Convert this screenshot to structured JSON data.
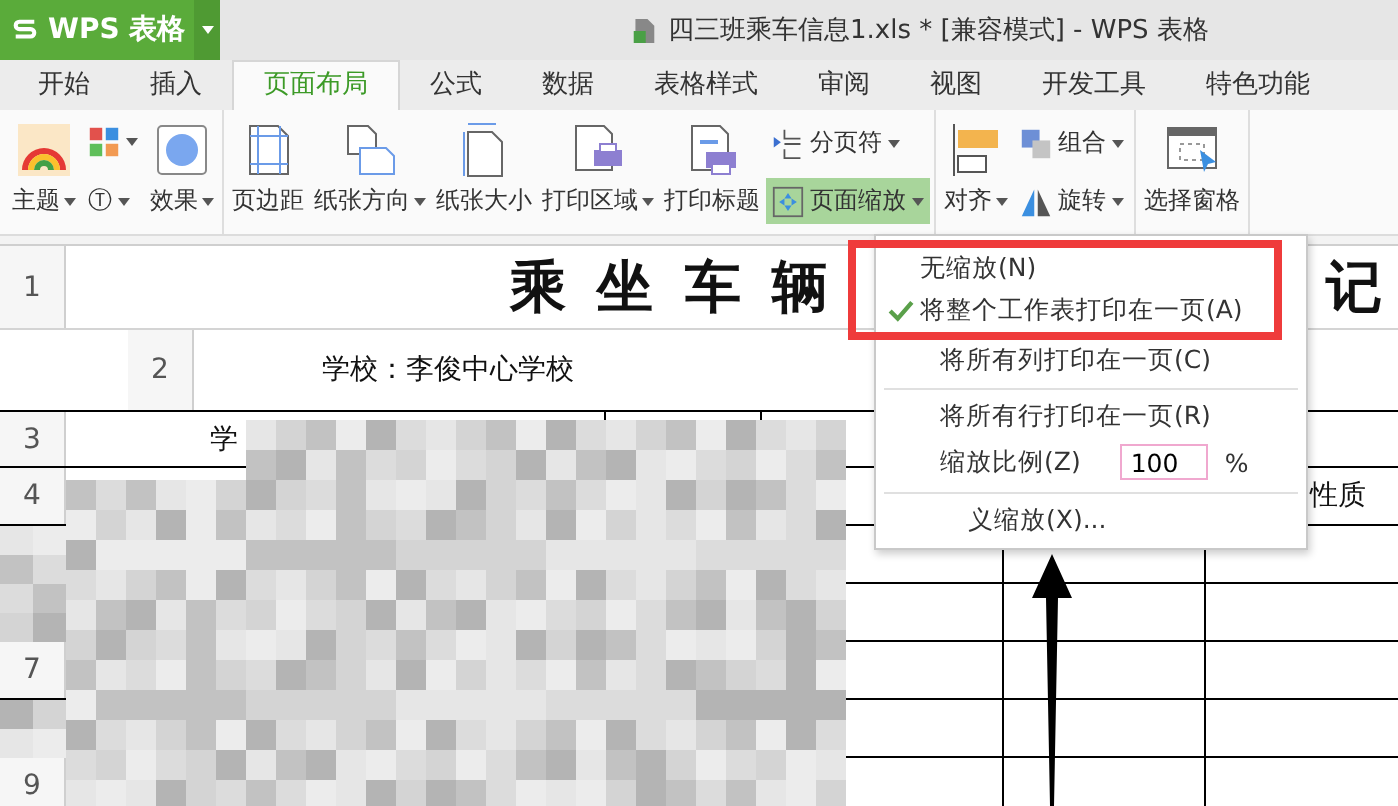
{
  "app": {
    "logo": "WPS 表格",
    "title": "四三班乘车信息1.xls * [兼容模式] - WPS 表格"
  },
  "tabs": [
    {
      "label": "开始",
      "selected": false
    },
    {
      "label": "插入",
      "selected": false
    },
    {
      "label": "页面布局",
      "selected": true
    },
    {
      "label": "公式",
      "selected": false
    },
    {
      "label": "数据",
      "selected": false
    },
    {
      "label": "表格样式",
      "selected": false
    },
    {
      "label": "审阅",
      "selected": false
    },
    {
      "label": "视图",
      "selected": false
    },
    {
      "label": "开发工具",
      "selected": false
    },
    {
      "label": "特色功能",
      "selected": false
    }
  ],
  "ribbon": [
    {
      "items": [
        {
          "kind": "big",
          "label": "主题",
          "dropdown": true,
          "pressed": false
        },
        {
          "kind": "stack",
          "items": [
            {
              "dropdown": true,
              "pressed": false
            },
            {
              "label": "Ⓣ",
              "dropdown": true,
              "pressed": false
            }
          ]
        },
        {
          "kind": "big",
          "label": "效果",
          "dropdown": true,
          "pressed": false
        }
      ]
    },
    {
      "items": [
        {
          "kind": "big",
          "label": "页边距",
          "dropdown": false,
          "pressed": false
        },
        {
          "kind": "big",
          "label": "纸张方向",
          "dropdown": true,
          "pressed": false
        },
        {
          "kind": "big",
          "label": "纸张大小",
          "dropdown": false,
          "pressed": false
        },
        {
          "kind": "big",
          "label": "打印区域",
          "dropdown": true,
          "pressed": false
        },
        {
          "kind": "big",
          "label": "打印标题",
          "dropdown": false,
          "pressed": false
        },
        {
          "kind": "stack",
          "items": [
            {
              "label": "分页符",
              "dropdown": true,
              "pressed": false
            },
            {
              "label": "页面缩放",
              "dropdown": true,
              "pressed": true
            }
          ]
        }
      ]
    },
    {
      "items": [
        {
          "kind": "big",
          "label": "对齐",
          "dropdown": true,
          "pressed": false
        },
        {
          "kind": "stack",
          "items": [
            {
              "label": "组合",
              "dropdown": true,
              "pressed": false
            },
            {
              "label": "旋转",
              "dropdown": true,
              "pressed": false
            }
          ]
        }
      ]
    },
    {
      "items": [
        {
          "kind": "big",
          "label": "选择窗格",
          "dropdown": false,
          "pressed": false
        }
      ]
    }
  ],
  "zoom_menu": {
    "items": [
      {
        "kind": "option",
        "label": "无缩放(N)",
        "checked": false,
        "highlighted": true
      },
      {
        "kind": "option",
        "label": "将整个工作表打印在一页(A)",
        "checked": true,
        "highlighted": true
      },
      {
        "kind": "option",
        "label": "将所有列打印在一页(C)",
        "checked": false,
        "highlighted": false
      },
      {
        "kind": "separator"
      },
      {
        "kind": "option",
        "label": "将所有行打印在一页(R)",
        "checked": false,
        "highlighted": false
      },
      {
        "kind": "scale",
        "label": "缩放比例(Z)",
        "value": "100",
        "unit": "%"
      },
      {
        "kind": "separator"
      },
      {
        "kind": "option",
        "label": "义缩放(X)...",
        "checked": false,
        "highlighted": false
      }
    ]
  },
  "sheet": {
    "obscured": true,
    "rows": [
      {
        "kind": "title",
        "header": "1",
        "title": "乘 坐 车 辆",
        "title_end": "记"
      },
      {
        "kind": "info",
        "header": "2",
        "first_cell": "学校：李俊中心学校"
      },
      {
        "kind": "table",
        "header": "3",
        "first_cell": "学"
      },
      {
        "kind": "table",
        "header": "4",
        "last_cell": "性质"
      },
      {
        "kind": "table"
      },
      {
        "kind": "table"
      },
      {
        "kind": "table",
        "header": "7"
      },
      {
        "kind": "table"
      },
      {
        "kind": "table",
        "header": "9"
      }
    ]
  },
  "annotations": [
    {
      "kind": "arrow"
    }
  ]
}
